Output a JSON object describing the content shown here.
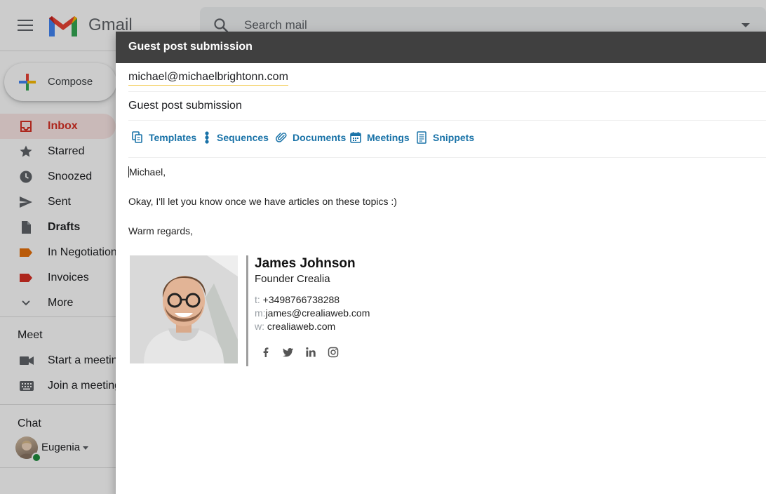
{
  "app": {
    "name": "Gmail"
  },
  "search": {
    "placeholder": "Search mail"
  },
  "compose_button": {
    "label": "Compose"
  },
  "nav": {
    "items": [
      {
        "label": "Inbox",
        "icon": "inbox-icon",
        "active": true
      },
      {
        "label": "Starred",
        "icon": "star-icon"
      },
      {
        "label": "Snoozed",
        "icon": "clock-icon"
      },
      {
        "label": "Sent",
        "icon": "send-icon"
      },
      {
        "label": "Drafts",
        "icon": "draft-icon",
        "bold": true
      },
      {
        "label": "In Negotiation",
        "icon": "label-icon"
      },
      {
        "label": "Invoices",
        "icon": "label-icon"
      },
      {
        "label": "More",
        "icon": "chevron-down-icon"
      }
    ]
  },
  "meet": {
    "title": "Meet",
    "items": [
      {
        "label": "Start a meeting",
        "icon": "video-icon"
      },
      {
        "label": "Join a meeting",
        "icon": "keyboard-icon"
      }
    ]
  },
  "chat": {
    "title": "Chat",
    "user": "Eugenia"
  },
  "compose": {
    "title": "Guest post submission",
    "to": "michael@michaelbrightonn.com",
    "subject": "Guest post submission",
    "toolbar": [
      {
        "label": "Templates",
        "icon": "templates-icon"
      },
      {
        "label": "Sequences",
        "icon": "sequences-icon"
      },
      {
        "label": "Documents",
        "icon": "paperclip-icon"
      },
      {
        "label": "Meetings",
        "icon": "calendar-icon"
      },
      {
        "label": "Snippets",
        "icon": "snippets-icon"
      }
    ],
    "body": {
      "greeting": "Michael,",
      "line1": "Okay, I'll let you know once we have articles on these topics :)",
      "closing": "Warm regards,"
    },
    "signature": {
      "name": "James Johnson",
      "role": "Founder Crealia",
      "phone_key": "t:",
      "phone": "+3498766738288",
      "email_key": "m:",
      "email": "james@crealiaweb.com",
      "web_key": "w:",
      "web": "crealiaweb.com",
      "social": [
        "facebook-icon",
        "twitter-icon",
        "linkedin-icon",
        "instagram-icon"
      ]
    }
  },
  "colors": {
    "header_bg": "#404040",
    "toolbar_link": "#1a73a8",
    "gmail_red": "#d93025",
    "active_nav_bg": "#fce8e6"
  }
}
